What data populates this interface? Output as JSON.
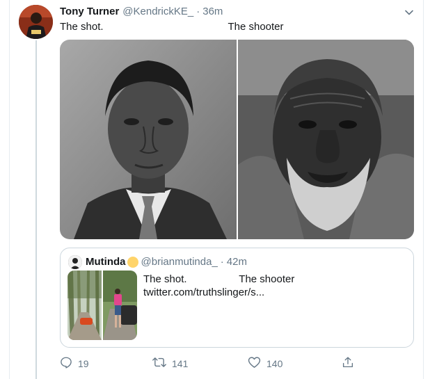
{
  "tweet": {
    "display_name": "Tony Turner",
    "handle": "@KendrickKE_",
    "separator": "·",
    "time": "36m",
    "text": "The shot.                                           The shooter",
    "media": [
      {
        "icon": "bw-portrait-young-man"
      },
      {
        "icon": "bw-portrait-elderly-man"
      }
    ]
  },
  "quote": {
    "display_name": "Mutinda",
    "handle": "@brianmutinda_",
    "separator": "·",
    "time": "42m",
    "text": "The shot.                  The shooter\ntwitter.com/truthslinger/s..."
  },
  "actions": {
    "reply_count": "19",
    "retweet_count": "141",
    "like_count": "140"
  },
  "colors": {
    "secondary_text": "#657786",
    "border": "#ccd6dd"
  }
}
